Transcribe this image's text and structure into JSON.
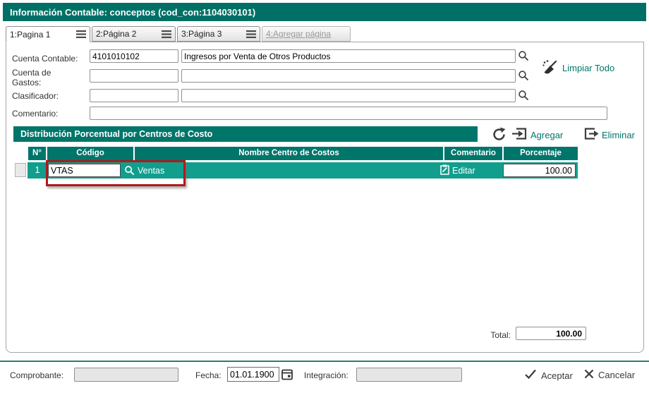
{
  "window": {
    "title": "Información Contable: conceptos (cod_con:1104030101)"
  },
  "tabs": [
    {
      "label": "1:Pagina 1",
      "active": true
    },
    {
      "label": "2:Página 2",
      "active": false
    },
    {
      "label": "3:Página 3",
      "active": false
    },
    {
      "label": "4:Agregar página",
      "active": false,
      "disabled": true
    }
  ],
  "form": {
    "cuenta_contable": {
      "label": "Cuenta Contable:",
      "code": "4101010102",
      "name": "Ingresos por Venta de Otros Productos"
    },
    "cuenta_gastos": {
      "label": "Cuenta de Gastos:",
      "code": "",
      "name": ""
    },
    "clasificador": {
      "label": "Clasificador:",
      "code": "",
      "name": ""
    },
    "comentario": {
      "label": "Comentario:",
      "value": ""
    },
    "limpiar_todo_label": "Limpiar Todo"
  },
  "distribution": {
    "title": "Distribución Porcentual por Centros de Costo",
    "actions": {
      "agregar": "Agregar",
      "eliminar": "Eliminar"
    },
    "table": {
      "headers": [
        "N°",
        "Código",
        "Nombre Centro de Costos",
        "Comentario",
        "Porcentaje"
      ],
      "rows": [
        {
          "num": "1",
          "codigo": "VTAS",
          "nombre": "Ventas",
          "editar_label": "Editar",
          "porcentaje": "100.00"
        }
      ]
    },
    "total": {
      "label": "Total:",
      "value": "100.00"
    }
  },
  "footer": {
    "comprobante": {
      "label": "Comprobante:",
      "value": ""
    },
    "fecha": {
      "label": "Fecha:",
      "value": "01.01.1900"
    },
    "integracion": {
      "label": "Integración:",
      "value": ""
    },
    "aceptar_label": "Aceptar",
    "cancelar_label": "Cancelar"
  },
  "icons": {
    "tab-menu": "hamburger",
    "search": "magnifier",
    "limpiar": "broom",
    "refresh": "circular-arrow",
    "agregar": "arrow-into-bracket",
    "eliminar": "arrow-out-of-bracket",
    "editar": "clipboard-pencil",
    "fecha": "calendar",
    "aceptar": "check-mark",
    "cancelar": "x-mark"
  },
  "colors": {
    "teal_dark": "#007066",
    "teal_header": "#00756A",
    "row_teal": "#119E8D",
    "annotation_red": "#B01A1A",
    "disabled_field": "#e6e6e6"
  }
}
